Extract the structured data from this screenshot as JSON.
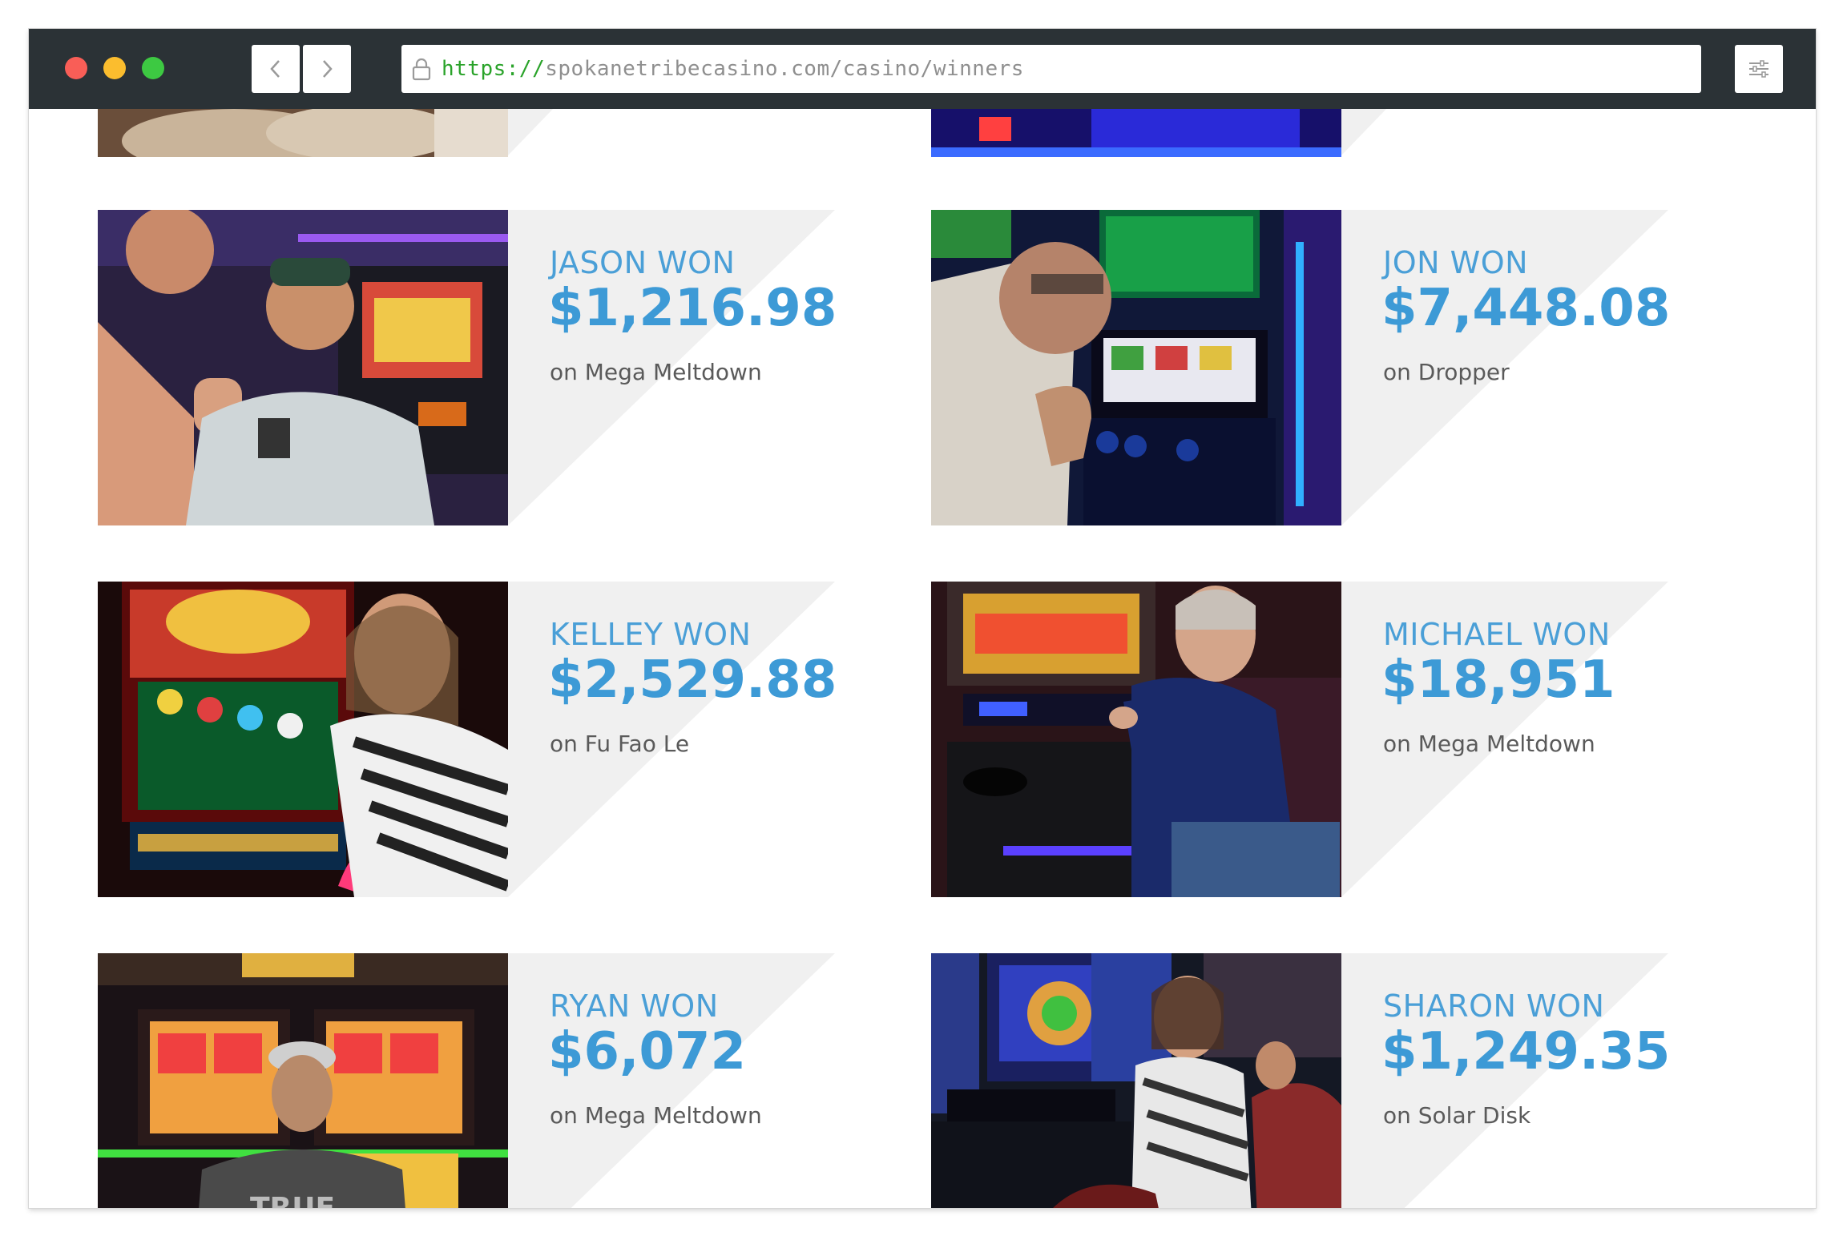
{
  "browser": {
    "url_scheme": "https://",
    "url_rest": "spokanetribecasino.com/casino/winners"
  },
  "winners": [
    {
      "name": "JASON WON",
      "amount": "$1,216.98",
      "game": "on Mega Meltdown"
    },
    {
      "name": "JON WON",
      "amount": "$7,448.08",
      "game": "on Dropper"
    },
    {
      "name": "KELLEY WON",
      "amount": "$2,529.88",
      "game": "on Fu Fao Le"
    },
    {
      "name": "MICHAEL WON",
      "amount": "$18,951",
      "game": "on Mega Meltdown"
    },
    {
      "name": "RYAN WON",
      "amount": "$6,072",
      "game": "on Mega Meltdown"
    },
    {
      "name": "SHARON WON",
      "amount": "$1,249.35",
      "game": "on Solar Disk"
    }
  ],
  "colors": {
    "accent": "#3d9ad6",
    "titlebar": "#2b3236",
    "diagonal": "#f0f0f0"
  }
}
